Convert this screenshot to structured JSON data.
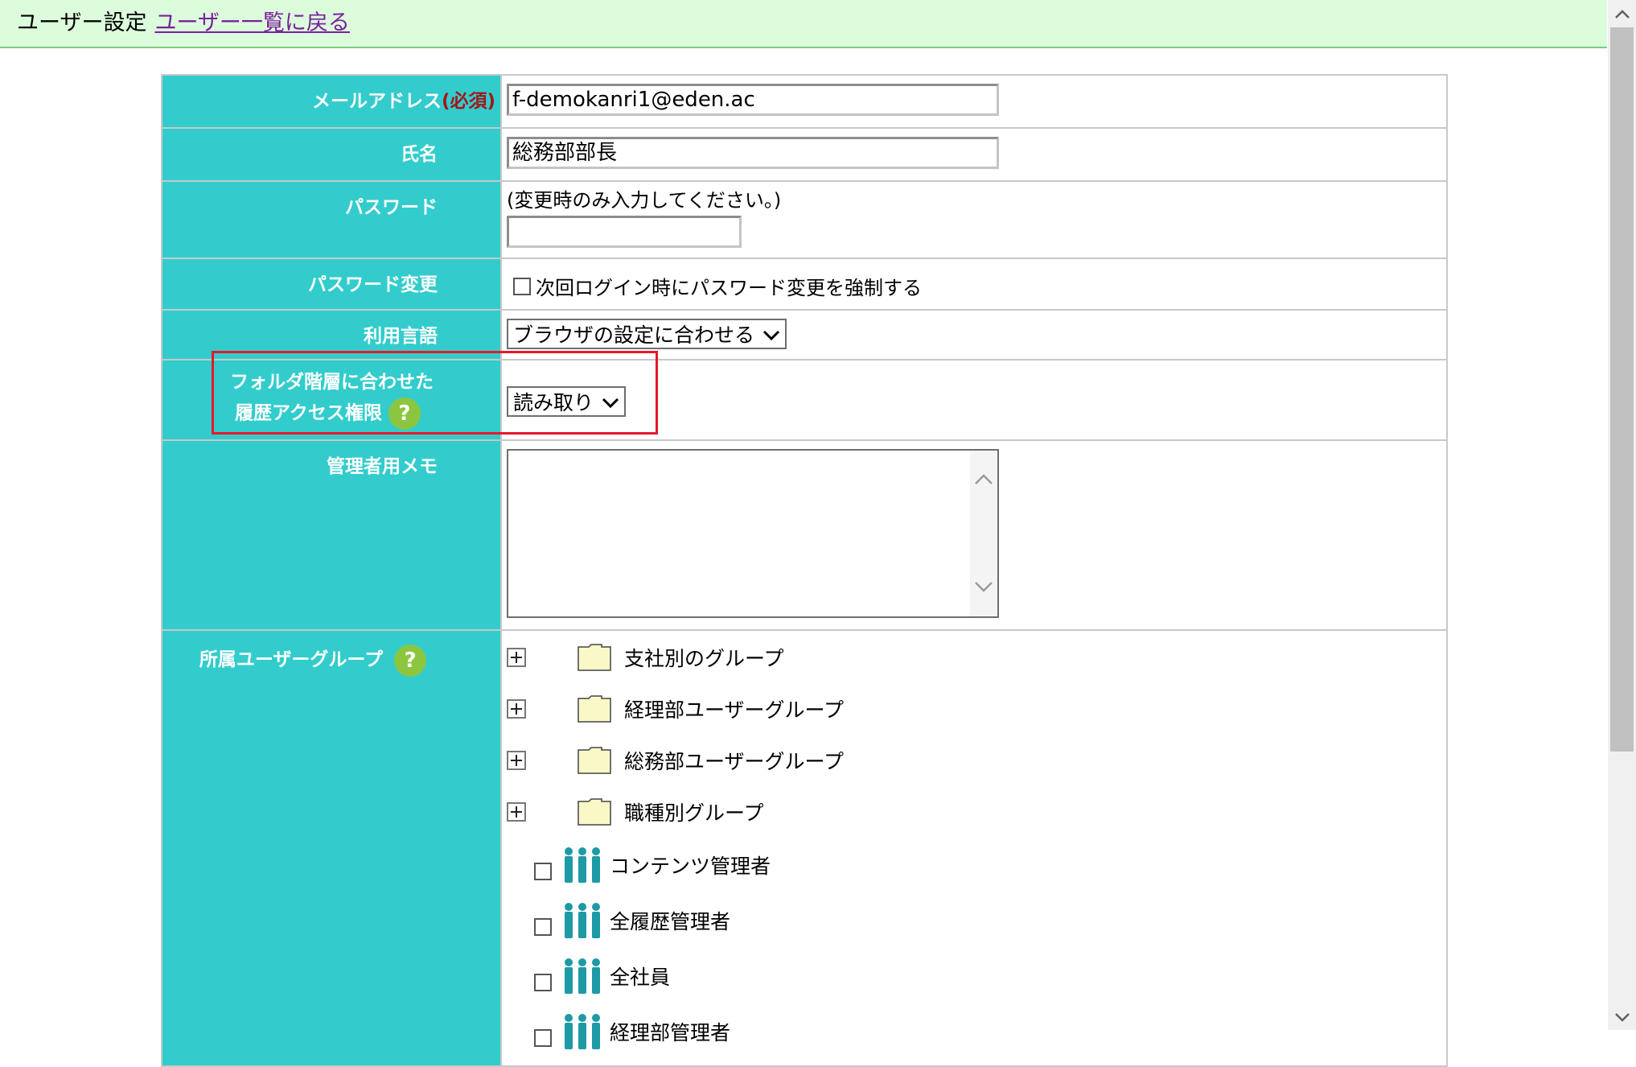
{
  "header": {
    "title": "ユーザー設定",
    "back_link": "ユーザー一覧に戻る"
  },
  "form": {
    "email": {
      "label": "メールアドレス",
      "required_mark": "(必須)",
      "value": "f-demokanri1@eden.ac"
    },
    "name": {
      "label": "氏名",
      "value": "総務部部長"
    },
    "password": {
      "label": "パスワード",
      "hint": "(変更時のみ入力してください。)",
      "value": ""
    },
    "password_change": {
      "label": "パスワード変更",
      "option": "次回ログイン時にパスワード変更を強制する"
    },
    "language": {
      "label": "利用言語",
      "selected": "ブラウザの設定に合わせる"
    },
    "history_access": {
      "label_line1": "フォルダ階層に合わせた",
      "label_line2": "履歴アクセス権限",
      "selected": "読み取り"
    },
    "memo": {
      "label": "管理者用メモ",
      "value": ""
    },
    "groups": {
      "label": "所属ユーザーグループ",
      "folders": [
        "支社別のグループ",
        "経理部ユーザーグループ",
        "総務部ユーザーグループ",
        "職種別グループ"
      ],
      "items": [
        "コンテンツ管理者",
        "全履歴管理者",
        "全社員",
        "経理部管理者"
      ]
    }
  },
  "colors": {
    "label_bg": "#33cccc",
    "header_bg": "#dcfddc",
    "highlight": "#e8172a",
    "help_icon": "#8cc63f"
  },
  "icons": {
    "help": "help-icon",
    "folder": "folder-icon",
    "expand": "plus-icon",
    "group": "people-icon",
    "dropdown": "chevron-down-icon"
  }
}
